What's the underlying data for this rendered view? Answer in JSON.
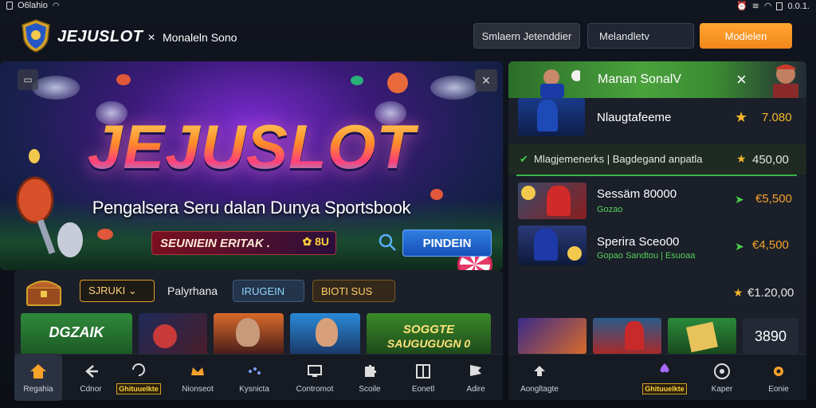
{
  "status_bar": {
    "left_text": "O6lahio",
    "right_text": "0.0.1."
  },
  "header": {
    "brand": "JEJUSLOT",
    "brand_separator": "×",
    "brand_sub": "Monaleln Sono",
    "btn_1": "Smlaern Jetenddier",
    "btn_2": "Melandletv",
    "btn_3": "Modielen",
    "accent_orange": "#f7951f"
  },
  "hero": {
    "title": "JEJUSLOT",
    "subtitle": "Pengalsera Seru dalan Dunya Sportsbook",
    "pill_text": "SEUNIEIN ERITAK .",
    "pill_tag": "✿ 8U",
    "cta": "PINDEIN",
    "close_icon": "×",
    "min_icon": "▭"
  },
  "games": {
    "tab_1": "SJRUKI ⌄",
    "tab_2": "Palyrhana",
    "tab_3": "IRUGEIN",
    "tab_4": "BIOTI SUS",
    "card_1": "DGZAIK",
    "card_5_line1": "SOGGTE",
    "card_5_line2": "SAUGUGUGN 0"
  },
  "nav_left": [
    {
      "label": "Regahia",
      "icon": "home-icon"
    },
    {
      "label": "Cdnor",
      "icon": "back-arrow-icon"
    },
    {
      "label": "Ghituuelkte",
      "icon": "refresh-icon",
      "gold": true
    },
    {
      "label": "Nionseot",
      "icon": "crown-icon"
    },
    {
      "label": "Kysnicta",
      "icon": "dots-icon"
    },
    {
      "label": "Contromot",
      "icon": "monitor-icon"
    },
    {
      "label": "Scoile",
      "icon": "puzzle-icon"
    },
    {
      "label": "Eonetl",
      "icon": "cards-icon"
    },
    {
      "label": "Adire",
      "icon": "flag-icon"
    }
  ],
  "nav_right": [
    {
      "label": "Aongltagte",
      "icon": "upload-icon"
    },
    {
      "label": "Ghituuelkte",
      "icon": "spade-icon",
      "gold": true
    },
    {
      "label": "Kaper",
      "icon": "soccer-icon"
    },
    {
      "label": "Eonie",
      "icon": "gear-icon"
    }
  ],
  "right_panel": {
    "title": "Manan SonalV",
    "close": "×",
    "row_1_title": "Nlaugtafeeme",
    "row_1_value": "7.080",
    "row_2_title": "Mlagjemenerks | Bagdegand anpatla",
    "row_2_value": "450,00",
    "row_3_title": "Sessäm 80000",
    "row_3_sub": "Gozao",
    "row_3_value": "€5,500",
    "row_4_title": "Sperira Sceo00",
    "row_4_sub": "Gopao Sandtou | Esuoaa",
    "row_4_value": "€4,500",
    "row_5_value": "€1.20,00",
    "row_6_value": "3890"
  }
}
